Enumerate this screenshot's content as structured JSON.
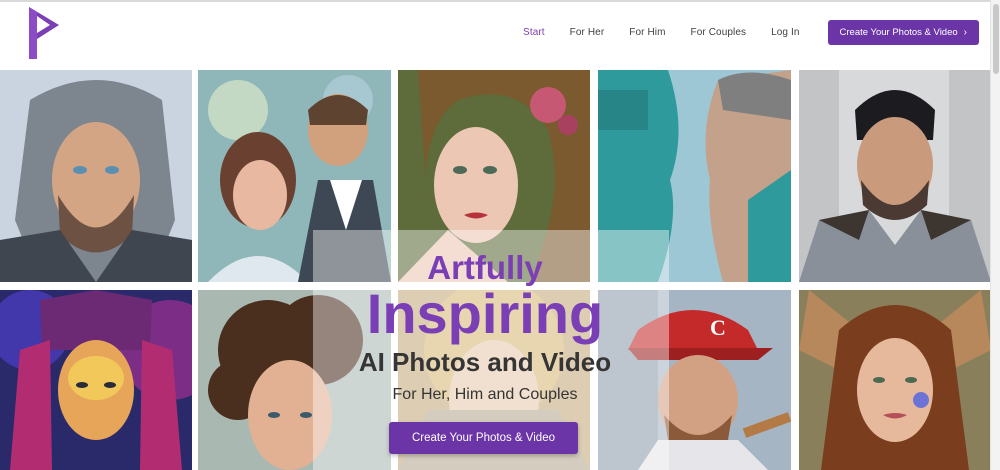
{
  "brand": {
    "logo_icon": "letter-p-logo-icon",
    "color": "#7a3fb4"
  },
  "nav": {
    "items": [
      {
        "label": "Start",
        "active": true
      },
      {
        "label": "For Her",
        "active": false
      },
      {
        "label": "For Him",
        "active": false
      },
      {
        "label": "For Couples",
        "active": false
      },
      {
        "label": "Log In",
        "active": false
      }
    ],
    "cta_label": "Create Your Photos & Video",
    "cta_icon": "chevron-right-icon"
  },
  "hero": {
    "line1": "Artfully",
    "line2": "Inspiring",
    "line3": "AI Photos and Video",
    "line4": "For Her, Him and Couples",
    "button_label": "Create Your Photos & Video"
  },
  "colors": {
    "accent": "#7a3fb4",
    "button": "#6b35a8",
    "heading_dark": "#353535"
  }
}
